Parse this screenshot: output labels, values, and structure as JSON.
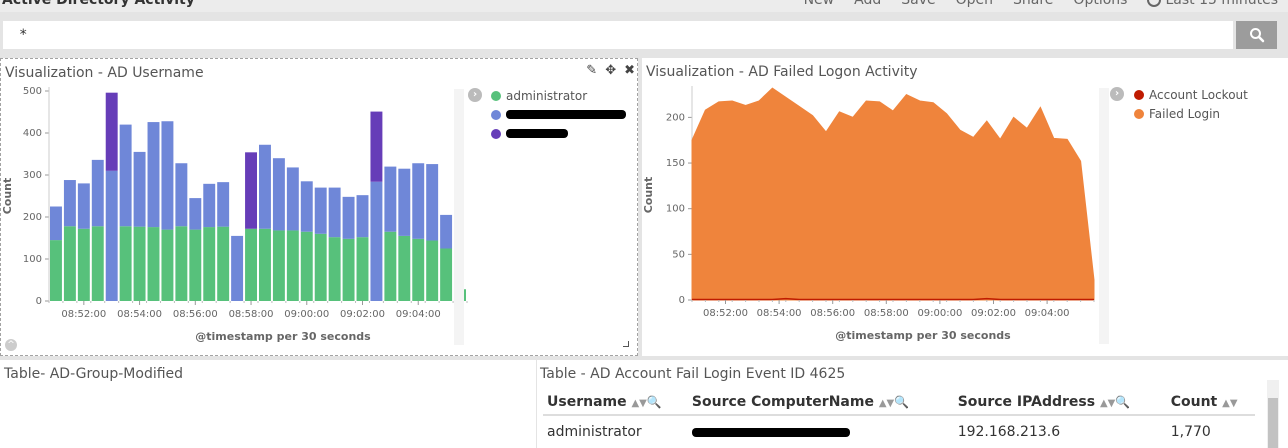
{
  "header": {
    "title": "Active Directory Activity",
    "menu": [
      "New",
      "Add",
      "Save",
      "Open",
      "Share",
      "Options"
    ],
    "time_range": "Last 15 minutes"
  },
  "search": {
    "value": "*"
  },
  "colors": {
    "administrator": "#57c17b",
    "user2": "#6f87d8",
    "user3": "#663db8",
    "failed_login": "#ef843c",
    "account_lockout": "#bf1b00"
  },
  "panel_username": {
    "title": "Visualization - AD Username",
    "legend": [
      "administrator"
    ],
    "chart_data": {
      "type": "bar",
      "stacked": true,
      "xlabel": "@timestamp per 30 seconds",
      "ylabel": "Count",
      "ylim": [
        0,
        500
      ],
      "yticks": [
        0,
        100,
        200,
        300,
        400,
        500
      ],
      "xticks": [
        "08:52:00",
        "08:54:00",
        "08:56:00",
        "08:58:00",
        "09:00:00",
        "09:02:00",
        "09:04:00"
      ],
      "series": [
        {
          "name": "administrator",
          "values": [
            145,
            178,
            172,
            178,
            0,
            178,
            177,
            176,
            170,
            178,
            170,
            176,
            177,
            0,
            172,
            172,
            168,
            168,
            165,
            160,
            152,
            148,
            152,
            0,
            165,
            155,
            148,
            144,
            125,
            28
          ]
        },
        {
          "values": [
            80,
            110,
            108,
            158,
            310,
            242,
            178,
            250,
            258,
            150,
            75,
            103,
            106,
            155,
            0,
            200,
            172,
            150,
            120,
            110,
            118,
            100,
            100,
            284,
            155,
            160,
            180,
            182,
            80,
            0
          ]
        },
        {
          "values": [
            0,
            0,
            0,
            0,
            186,
            0,
            0,
            0,
            0,
            0,
            0,
            0,
            0,
            0,
            182,
            0,
            0,
            0,
            0,
            0,
            0,
            0,
            0,
            167,
            0,
            0,
            0,
            0,
            0,
            0
          ]
        }
      ]
    }
  },
  "panel_failed": {
    "title": "Visualization - AD Failed Logon Activity",
    "legend": [
      "Account Lockout",
      "Failed Login"
    ],
    "chart_data": {
      "type": "area",
      "xlabel": "@timestamp per 30 seconds",
      "ylabel": "Count",
      "ylim": [
        0,
        230
      ],
      "yticks": [
        0,
        50,
        100,
        150,
        200
      ],
      "xticks": [
        "08:52:00",
        "08:54:00",
        "08:56:00",
        "08:58:00",
        "09:00:00",
        "09:02:00",
        "09:04:00"
      ],
      "series": [
        {
          "name": "Failed Login",
          "values": [
            175,
            208,
            217,
            218,
            213,
            218,
            232,
            222,
            212,
            202,
            184,
            206,
            200,
            218,
            217,
            207,
            225,
            218,
            216,
            204,
            186,
            178,
            196,
            176,
            200,
            188,
            211,
            177,
            176,
            152,
            22
          ]
        },
        {
          "name": "Account Lockout",
          "values": [
            0,
            0,
            0,
            0,
            0,
            0,
            0,
            1,
            0,
            0,
            0,
            0,
            0,
            0,
            0,
            0,
            0,
            0,
            0,
            0,
            0,
            0,
            1,
            0,
            0,
            0,
            0,
            0,
            0,
            0,
            0
          ]
        }
      ]
    }
  },
  "panel_group": {
    "title": "Table- AD-Group-Modified"
  },
  "panel_table": {
    "title": "Table - AD Account Fail Login Event ID 4625",
    "columns": [
      "Username",
      "Source ComputerName",
      "Source IPAddress",
      "Count"
    ],
    "rows": [
      {
        "username": "administrator",
        "ip": "192.168.213.6",
        "count": "1,770"
      }
    ]
  }
}
